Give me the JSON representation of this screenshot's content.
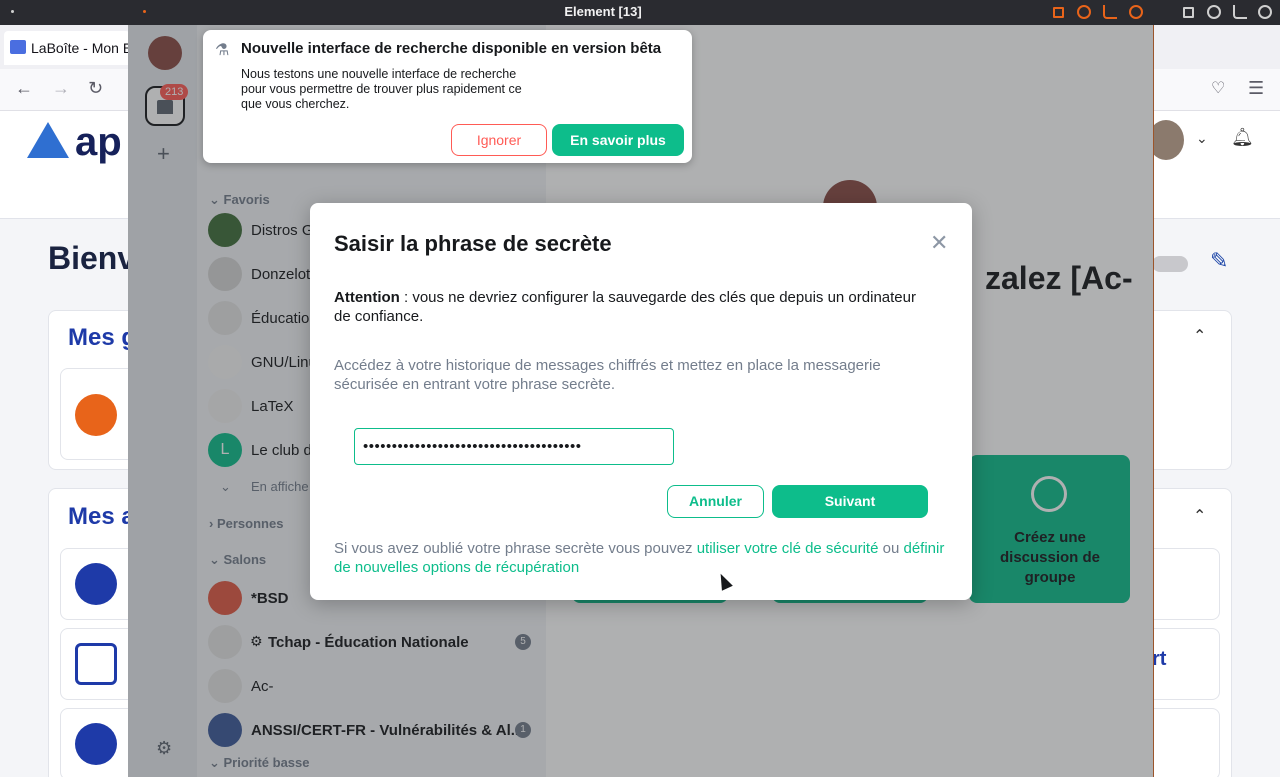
{
  "window": {
    "title": "Element [13]"
  },
  "browser": {
    "tab_label": "LaBoîte - Mon E",
    "logo_text": "ap",
    "welcome": "Bienv",
    "section_groups": "Mes g",
    "section_apps": "Mes a",
    "partial_right_text": "rt"
  },
  "spaces": {
    "home_badge": "213"
  },
  "toast": {
    "title": "Nouvelle interface de recherche disponible en version bêta",
    "body": "Nous testons une nouvelle interface de recherche pour vous permettre de trouver plus rapidement ce que vous cherchez.",
    "ignore_label": "Ignorer",
    "more_label": "En savoir plus"
  },
  "roomlist": {
    "favorites_header": "Favoris",
    "favorites": [
      {
        "name": "Distros G"
      },
      {
        "name": "Donzelot"
      },
      {
        "name": "Éducatio"
      },
      {
        "name": "GNU/Linu"
      },
      {
        "name": "LaTeX"
      },
      {
        "name": "Le club d"
      }
    ],
    "show_more": "En affiche",
    "people_header": "Personnes",
    "rooms_header": "Salons",
    "rooms": [
      {
        "name": "*BSD",
        "bold": true
      },
      {
        "name": "Tchap - Éducation Nationale",
        "bold": true,
        "count": "5"
      },
      {
        "name": "Ac-",
        "bold": false
      },
      {
        "name": "ANSSI/CERT-FR - Vulnérabilités & Al...",
        "bold": true,
        "count": "1"
      }
    ],
    "low_priority_header": "Priorité basse"
  },
  "main": {
    "display_name_partial": "zalez [Ac-",
    "tile_group_label": "Créez une discussion de groupe"
  },
  "dialog": {
    "title": "Saisir la phrase de secrète",
    "warning_bold": "Attention",
    "warning_text": " : vous ne devriez configurer la sauvegarde des clés que depuis un ordinateur de confiance.",
    "info": "Accédez à votre historique de messages chiffrés et mettez en place la messagerie sécurisée en entrant votre phrase secrète.",
    "passphrase_value": "••••••••••••••••••••••••••••••••••••••",
    "cancel_label": "Annuler",
    "next_label": "Suivant",
    "footer_prefix": "Si vous avez oublié votre phrase secrète vous pouvez ",
    "footer_link1": "utiliser votre clé de sécurité",
    "footer_mid": " ou ",
    "footer_link2": "définir de nouvelles options de récupération"
  },
  "colors": {
    "accent": "#0dbd8b",
    "alert": "#ff5b55",
    "wm_orange": "#e8641a"
  }
}
